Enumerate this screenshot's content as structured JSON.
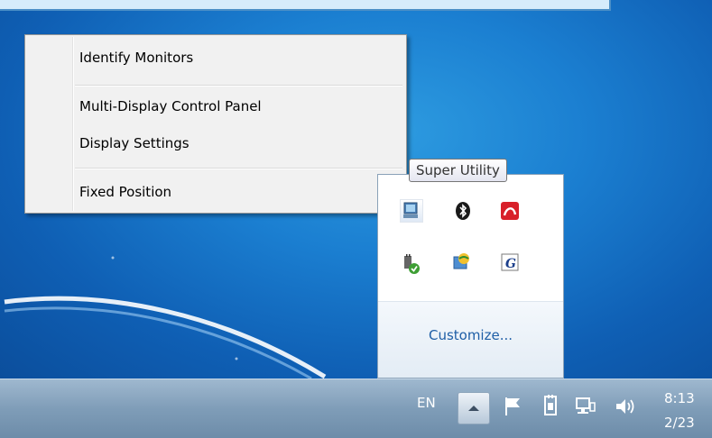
{
  "context_menu": {
    "items": [
      {
        "label": "Identify Monitors"
      },
      {
        "label": "Multi-Display Control Panel"
      },
      {
        "label": "Display Settings"
      },
      {
        "label": "Fixed Position"
      }
    ]
  },
  "tooltip": {
    "text": "Super Utility"
  },
  "tray_popup": {
    "icons": [
      "super-utility-icon",
      "bluetooth-icon",
      "antivirus-icon",
      "power-plug-icon",
      "network-globe-icon",
      "font-g-icon"
    ],
    "customize_label": "Customize..."
  },
  "taskbar": {
    "language": "EN",
    "icons": [
      "show-hidden-icons-arrow",
      "action-center-flag-icon",
      "power-icon",
      "network-icon",
      "volume-icon"
    ],
    "clock_time": "8:13",
    "clock_date": "2/23"
  }
}
